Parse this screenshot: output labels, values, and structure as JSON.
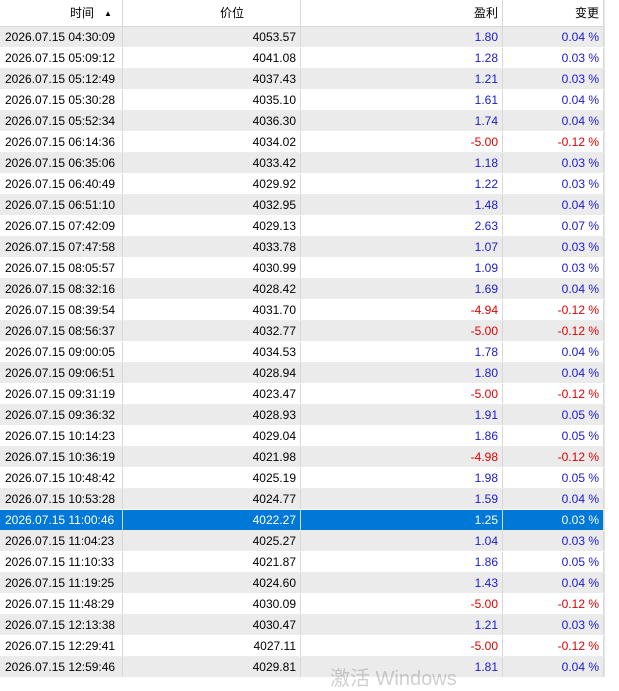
{
  "header": {
    "col_time": "时间",
    "col_price": "价位",
    "col_profit": "盈利",
    "col_change": "变更",
    "sort_indicator": "▲"
  },
  "colors": {
    "positive": "#1a1ad1",
    "negative": "#e00000",
    "selected": "#0078d7"
  },
  "rows": [
    {
      "time": "2026.07.15 04:30:09",
      "price": "4053.57",
      "profit": "1.80",
      "change": "0.04 %",
      "neg": false
    },
    {
      "time": "2026.07.15 05:09:12",
      "price": "4041.08",
      "profit": "1.28",
      "change": "0.03 %",
      "neg": false
    },
    {
      "time": "2026.07.15 05:12:49",
      "price": "4037.43",
      "profit": "1.21",
      "change": "0.03 %",
      "neg": false
    },
    {
      "time": "2026.07.15 05:30:28",
      "price": "4035.10",
      "profit": "1.61",
      "change": "0.04 %",
      "neg": false
    },
    {
      "time": "2026.07.15 05:52:34",
      "price": "4036.30",
      "profit": "1.74",
      "change": "0.04 %",
      "neg": false
    },
    {
      "time": "2026.07.15 06:14:36",
      "price": "4034.02",
      "profit": "-5.00",
      "change": "-0.12 %",
      "neg": true
    },
    {
      "time": "2026.07.15 06:35:06",
      "price": "4033.42",
      "profit": "1.18",
      "change": "0.03 %",
      "neg": false
    },
    {
      "time": "2026.07.15 06:40:49",
      "price": "4029.92",
      "profit": "1.22",
      "change": "0.03 %",
      "neg": false
    },
    {
      "time": "2026.07.15 06:51:10",
      "price": "4032.95",
      "profit": "1.48",
      "change": "0.04 %",
      "neg": false
    },
    {
      "time": "2026.07.15 07:42:09",
      "price": "4029.13",
      "profit": "2.63",
      "change": "0.07 %",
      "neg": false
    },
    {
      "time": "2026.07.15 07:47:58",
      "price": "4033.78",
      "profit": "1.07",
      "change": "0.03 %",
      "neg": false
    },
    {
      "time": "2026.07.15 08:05:57",
      "price": "4030.99",
      "profit": "1.09",
      "change": "0.03 %",
      "neg": false
    },
    {
      "time": "2026.07.15 08:32:16",
      "price": "4028.42",
      "profit": "1.69",
      "change": "0.04 %",
      "neg": false
    },
    {
      "time": "2026.07.15 08:39:54",
      "price": "4031.70",
      "profit": "-4.94",
      "change": "-0.12 %",
      "neg": true
    },
    {
      "time": "2026.07.15 08:56:37",
      "price": "4032.77",
      "profit": "-5.00",
      "change": "-0.12 %",
      "neg": true
    },
    {
      "time": "2026.07.15 09:00:05",
      "price": "4034.53",
      "profit": "1.78",
      "change": "0.04 %",
      "neg": false
    },
    {
      "time": "2026.07.15 09:06:51",
      "price": "4028.94",
      "profit": "1.80",
      "change": "0.04 %",
      "neg": false
    },
    {
      "time": "2026.07.15 09:31:19",
      "price": "4023.47",
      "profit": "-5.00",
      "change": "-0.12 %",
      "neg": true
    },
    {
      "time": "2026.07.15 09:36:32",
      "price": "4028.93",
      "profit": "1.91",
      "change": "0.05 %",
      "neg": false
    },
    {
      "time": "2026.07.15 10:14:23",
      "price": "4029.04",
      "profit": "1.86",
      "change": "0.05 %",
      "neg": false
    },
    {
      "time": "2026.07.15 10:36:19",
      "price": "4021.98",
      "profit": "-4.98",
      "change": "-0.12 %",
      "neg": true
    },
    {
      "time": "2026.07.15 10:48:42",
      "price": "4025.19",
      "profit": "1.98",
      "change": "0.05 %",
      "neg": false
    },
    {
      "time": "2026.07.15 10:53:28",
      "price": "4024.77",
      "profit": "1.59",
      "change": "0.04 %",
      "neg": false
    },
    {
      "time": "2026.07.15 11:00:46",
      "price": "4022.27",
      "profit": "1.25",
      "change": "0.03 %",
      "neg": false,
      "selected": true
    },
    {
      "time": "2026.07.15 11:04:23",
      "price": "4025.27",
      "profit": "1.04",
      "change": "0.03 %",
      "neg": false
    },
    {
      "time": "2026.07.15 11:10:33",
      "price": "4021.87",
      "profit": "1.86",
      "change": "0.05 %",
      "neg": false
    },
    {
      "time": "2026.07.15 11:19:25",
      "price": "4024.60",
      "profit": "1.43",
      "change": "0.04 %",
      "neg": false
    },
    {
      "time": "2026.07.15 11:48:29",
      "price": "4030.09",
      "profit": "-5.00",
      "change": "-0.12 %",
      "neg": true
    },
    {
      "time": "2026.07.15 12:13:38",
      "price": "4030.47",
      "profit": "1.21",
      "change": "0.03 %",
      "neg": false
    },
    {
      "time": "2026.07.15 12:29:41",
      "price": "4027.11",
      "profit": "-5.00",
      "change": "-0.12 %",
      "neg": true
    },
    {
      "time": "2026.07.15 12:59:46",
      "price": "4029.81",
      "profit": "1.81",
      "change": "0.04 %",
      "neg": false
    }
  ],
  "watermark": "激活 Windows"
}
